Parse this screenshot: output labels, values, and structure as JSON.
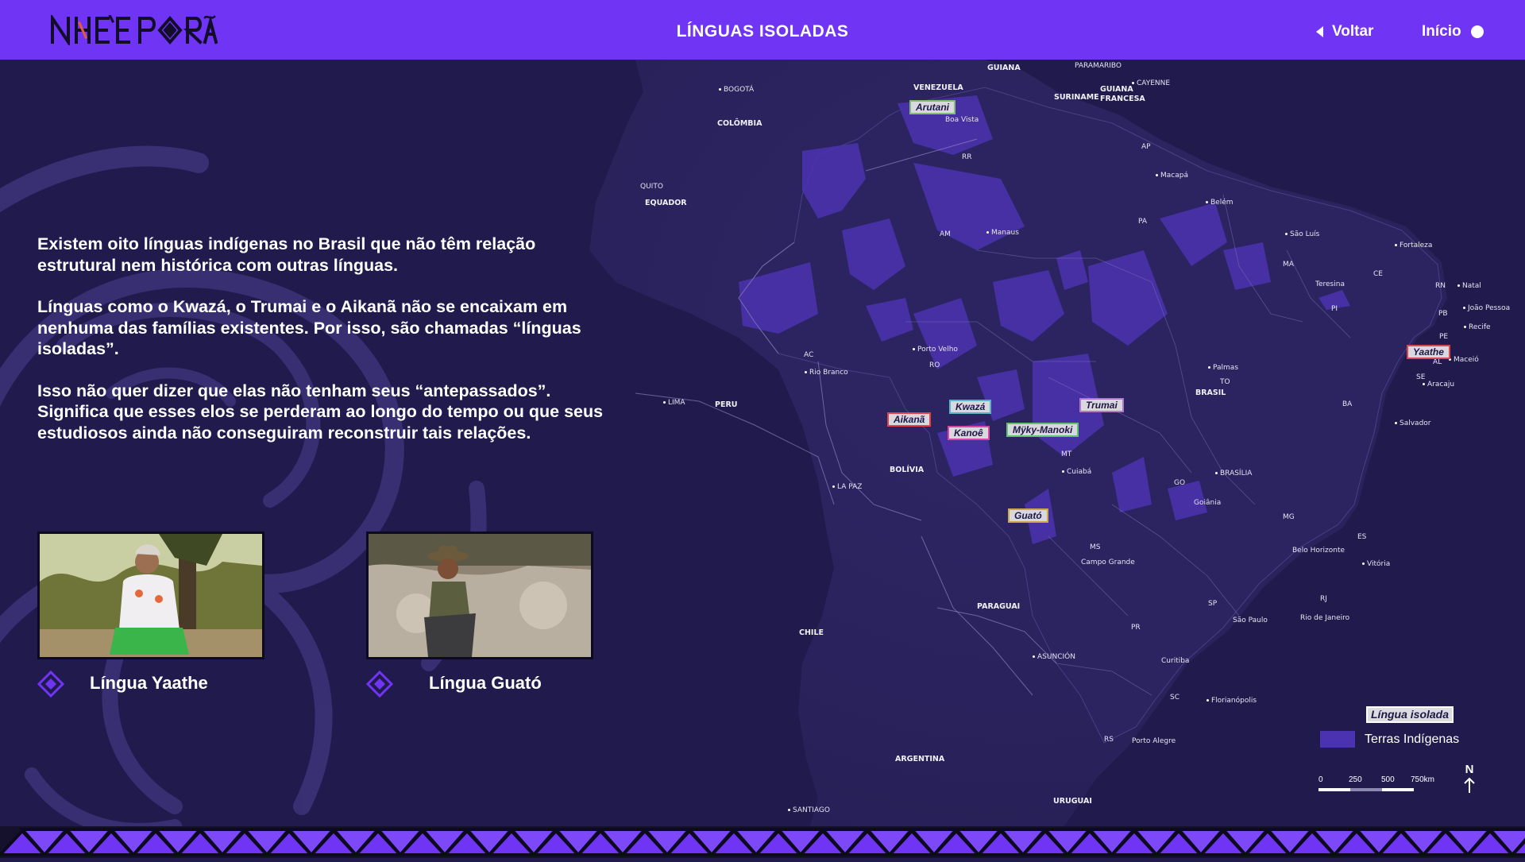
{
  "header": {
    "logo_text": "NHE'E PORÃ",
    "title": "LÍNGUAS ISOLADAS",
    "back_label": "Voltar",
    "home_label": "Início"
  },
  "intro": {
    "paragraphs": [
      "Existem oito línguas indígenas no Brasil que não têm relação estrutural nem histórica com outras línguas.",
      "Línguas como o Kwazá, o Trumai e o Aikanã não se encaixam em nenhuma das famílias existentes. Por isso, são chamadas “línguas isoladas”.",
      "Isso não quer dizer que elas não tenham seus “antepassados”. Significa que esses elos se perderam ao longo do tempo ou que seus estudiosos ainda não conseguiram reconstruir tais relações."
    ]
  },
  "cards": [
    {
      "label": "Língua Yaathe"
    },
    {
      "label": "Língua Guató"
    }
  ],
  "languages": [
    {
      "name": "Arutani",
      "color": "#7fbf6f"
    },
    {
      "name": "Aikanã",
      "color": "#e0434a"
    },
    {
      "name": "Kwazá",
      "color": "#56b5c4"
    },
    {
      "name": "Kanoê",
      "color": "#d9489e"
    },
    {
      "name": "Trumai",
      "color": "#b07ac9"
    },
    {
      "name": "Mÿky-Manoki",
      "color": "#5cc46d"
    },
    {
      "name": "Guató",
      "color": "#c8aa4a"
    },
    {
      "name": "Yaathe",
      "color": "#d8484e"
    }
  ],
  "places": {
    "countries": [
      "VENEZUELA",
      "GUIANA",
      "SURINAME",
      "GUIANA FRANCESA",
      "COLÔMBIA",
      "EQUADOR",
      "PERU",
      "BOLÍVIA",
      "CHILE",
      "PARAGUAI",
      "ARGENTINA",
      "URUGUAI",
      "BRASIL"
    ],
    "cities": [
      "PARAMARIBO",
      "CAYENNE",
      "BOGOTÁ",
      "Boa Vista",
      "QUITO",
      "Macapá",
      "Belém",
      "Manaus",
      "São Luís",
      "Fortaleza",
      "Teresina",
      "Natal",
      "João Pessoa",
      "Recife",
      "Maceió",
      "Aracaju",
      "Porto Velho",
      "Rio Branco",
      "LIMA",
      "Palmas",
      "Salvador",
      "Cuiabá",
      "BRASÍLIA",
      "Goiânia",
      "LA PAZ",
      "Belo Horizonte",
      "Vitória",
      "Campo Grande",
      "São Paulo",
      "Rio de Janeiro",
      "ASUNCIÓN",
      "Curitiba",
      "Florianópolis",
      "Porto Alegre",
      "SANTIAGO"
    ],
    "states": [
      "RR",
      "AP",
      "AM",
      "PA",
      "MA",
      "CE",
      "RN",
      "PB",
      "PE",
      "AL",
      "SE",
      "PI",
      "TO",
      "BA",
      "AC",
      "RO",
      "MT",
      "GO",
      "MG",
      "ES",
      "MS",
      "SP",
      "RJ",
      "PR",
      "SC",
      "RS"
    ]
  },
  "legend": {
    "isolated_label": "Língua isolada",
    "territories_label": "Terras Indígenas",
    "territories_color": "#4b32b0",
    "scale_ticks": [
      "0",
      "250",
      "500",
      "750km"
    ],
    "north_label": "N"
  },
  "colors": {
    "header": "#7034f5",
    "background": "#211a4d",
    "accent": "#7034f5"
  }
}
